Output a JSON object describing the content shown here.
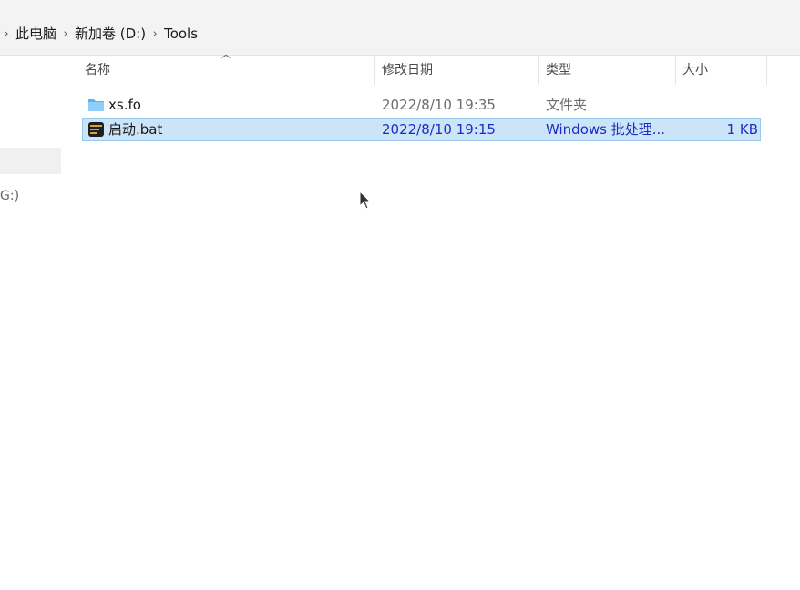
{
  "breadcrumb": {
    "items": [
      "此电脑",
      "新加卷 (D:)",
      "Tools"
    ]
  },
  "nav": {
    "drive_fragment": "G:)"
  },
  "columns": {
    "name": "名称",
    "date": "修改日期",
    "type": "类型",
    "size": "大小"
  },
  "sort_indicator": "^",
  "files": [
    {
      "name": "xs.fo",
      "date": "2022/8/10 19:35",
      "type": "文件夹",
      "size": "",
      "icon": "folder-icon",
      "selected": false
    },
    {
      "name": "启动.bat",
      "date": "2022/8/10 19:15",
      "type": "Windows 批处理...",
      "size": "1 KB",
      "icon": "batch-file-icon",
      "selected": true
    }
  ],
  "colors": {
    "selection_bg": "#cce4f7",
    "selection_border": "#99c9ef",
    "selection_text": "#1b2dc4",
    "folder": "#f8d775"
  }
}
